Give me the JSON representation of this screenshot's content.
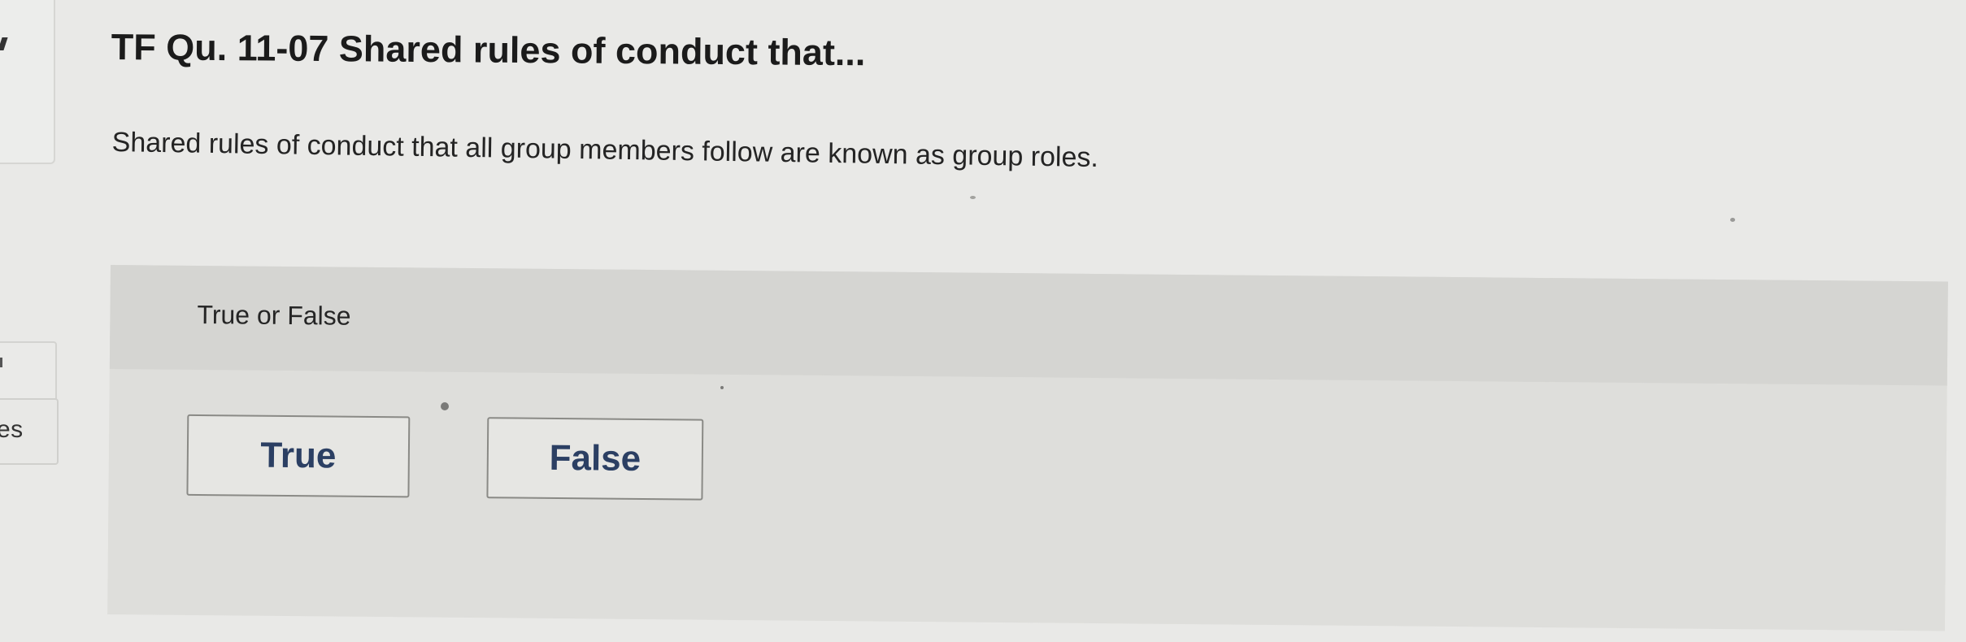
{
  "sidebar": {
    "partial_label": "es"
  },
  "question": {
    "title": "TF Qu. 11-07 Shared rules of conduct that...",
    "prompt": "Shared rules of conduct that all group members follow are known as group roles.",
    "answer_type": "True or False",
    "choices": [
      {
        "label": "True"
      },
      {
        "label": "False"
      }
    ]
  },
  "colors": {
    "page_background": "#e9e9e7",
    "answer_panel": "#dededb",
    "answer_header": "#d5d5d2",
    "choice_text": "#2b3f63",
    "choice_border": "#8a8a86"
  }
}
